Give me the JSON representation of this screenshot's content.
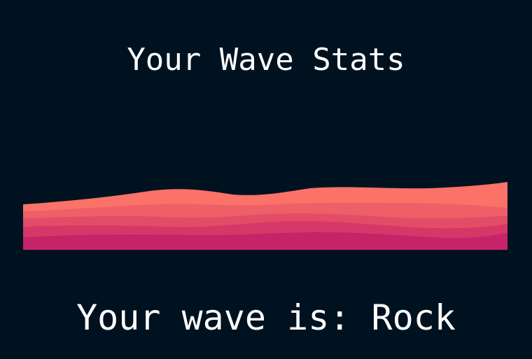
{
  "page": {
    "title": "Your Wave Stats",
    "result_text": "Your wave is: Rock"
  },
  "wave": {
    "layer_colors": [
      "#fa7268",
      "#ef5f67",
      "#e34c67",
      "#d53867",
      "#c62368"
    ]
  },
  "colors": {
    "background": "#001220",
    "text": "#ffffff"
  }
}
